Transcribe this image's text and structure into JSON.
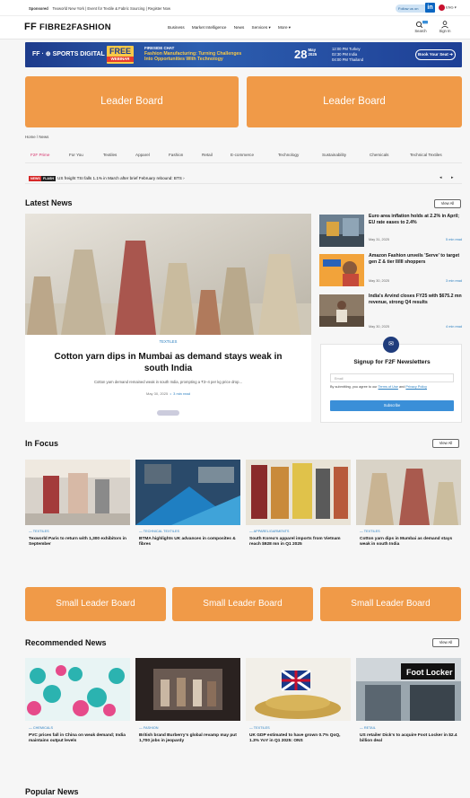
{
  "topbar": {
    "sponsored": "Sponsored",
    "sponsor_text": "Texworld New York | Event for Textile & Fabric Sourcing | Register Now",
    "follow": "Follow us on",
    "lang": "ENG"
  },
  "header": {
    "logo_mark": "FF",
    "logo_text": "FIBRE2FASHION",
    "nav": [
      "Business",
      "Market Intelligence",
      "News",
      "Services ▾",
      "More ▾"
    ],
    "search": "Search",
    "signin": "Sign In"
  },
  "banner": {
    "brand": "FF · ⊕ SPORTS DIGITAL",
    "free": "FREE",
    "webinar": "WEBINAR",
    "kicker": "FIRESIDE CHAT",
    "headline1": "Fashion Manufacturing: Turning Challenges",
    "headline2": "Into Opportunities With Technology",
    "day": "28",
    "month": "May",
    "year": "2025",
    "time1": "12:00 PM Turkey",
    "time2": "02:30 PM India",
    "time3": "04:00 PM Thailand",
    "book": "Book Your Seat ➔"
  },
  "leaderboards": {
    "lb1": "Leader Board",
    "lb2": "Leader Board",
    "s1": "Small Leader Board",
    "s2": "Small Leader Board",
    "s3": "Small Leader Board"
  },
  "breadcrumb": "Home / News",
  "category_tabs": [
    "F2F Prime",
    "For You",
    "Textiles",
    "Apparel",
    "Fashion",
    "Retail",
    "E-commerce",
    "Technology",
    "Sustainability",
    "Chemicals",
    "Technical Textiles"
  ],
  "flash": {
    "news": "NEWS",
    "flash": "FLASH",
    "text": "US freight TSI falls 1.1% in March after brief February rebound: BTS  ›"
  },
  "latest": {
    "title": "Latest News",
    "view_all": "View All",
    "hero": {
      "tag": "TEXTILES",
      "title": "Cotton yarn dips in Mumbai as demand stays weak in south India",
      "desc": "Cotton yarn demand remained weak in south India, prompting a ₹3–4 per kg price drop...",
      "date": "May 30, 2025",
      "read": "3 min read"
    },
    "side": [
      {
        "title": "Euro area inflation holds at 2.2% in April; EU rate eases to 2.4%",
        "date": "May 31, 2025",
        "read": "5 min read"
      },
      {
        "title": "Amazon Fashion unveils 'Serve' to target gen Z & tier II/III shoppers",
        "date": "May 30, 2025",
        "read": "3 min read"
      },
      {
        "title": "India's Arvind closes FY25 with $675.2 mn revenue, strong Q4 results",
        "date": "May 30, 2025",
        "read": "4 min read"
      }
    ]
  },
  "newsletter": {
    "title": "Signup for F2F Newsletters",
    "email_placeholder": "Email",
    "agree_pre": "By submitting, you agree to our ",
    "terms": "Terms of Use",
    "and": " and ",
    "privacy": "Privacy Policy",
    "subscribe": "Subscribe"
  },
  "infocus": {
    "title": "In Focus",
    "view_all": "View All",
    "cards": [
      {
        "tag": "— TEXTILES",
        "title": "Texworld Paris to return with 1,300 exhibitors in September"
      },
      {
        "tag": "— TECHNICAL TEXTILES",
        "title": "BTMA highlights UK advances in composites & fibres"
      },
      {
        "tag": "— APPAREL/GARMENTS",
        "title": "South Korea's apparel imports from Vietnam reach $928 mn in Q1 2025"
      },
      {
        "tag": "— TEXTILES",
        "title": "Cotton yarn dips in Mumbai as demand stays weak in south India"
      }
    ]
  },
  "recommended": {
    "title": "Recommended News",
    "view_all": "View All",
    "cards": [
      {
        "tag": "— CHEMICALS",
        "title": "PVC prices fall in China on weak demand; India maintains output levels"
      },
      {
        "tag": "— FASHION",
        "title": "British brand Burberry's global revamp may put 1,700 jobs in jeopardy"
      },
      {
        "tag": "— TEXTILES",
        "title": "UK GDP estimated to have grown 0.7% QoQ, 1.3% YoY in Q1 2025: ONS"
      },
      {
        "tag": "— RETAIL",
        "title": "US retailer Dick's to acquire Foot Locker in $2.4 billion deal"
      }
    ]
  },
  "popular": {
    "title": "Popular News"
  },
  "colors": {
    "accent": "#f09a48",
    "brand_blue": "#1e3c8c",
    "link": "#2a7fc0",
    "pink": "#d6336c"
  }
}
